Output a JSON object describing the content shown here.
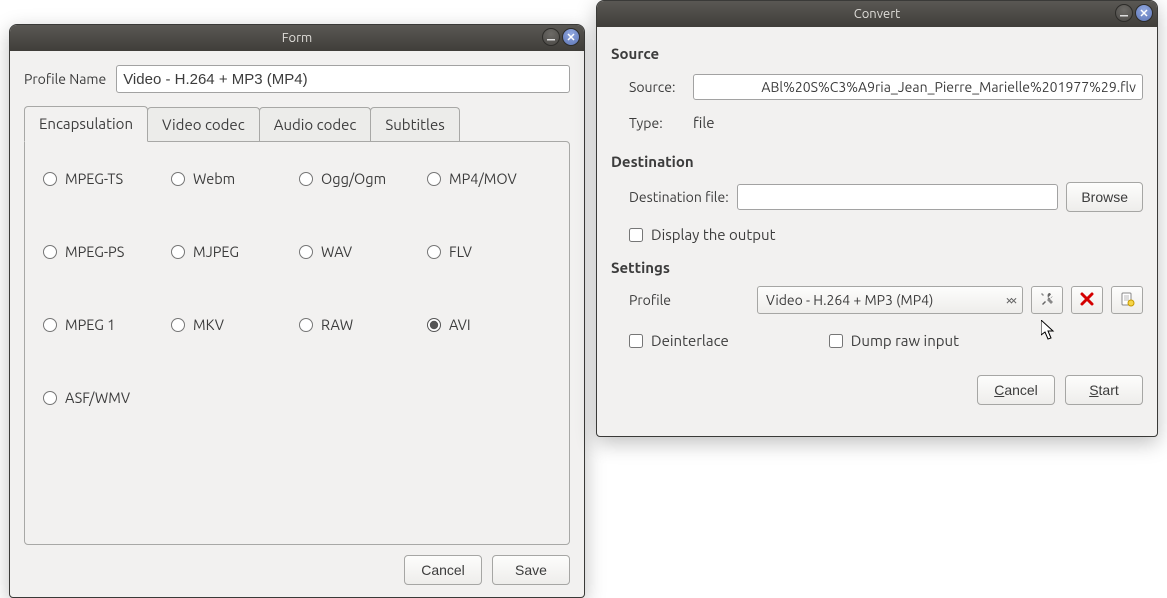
{
  "form_window": {
    "title": "Form",
    "profile_name_label": "Profile Name",
    "profile_name_value": "Video - H.264 + MP3 (MP4)",
    "tabs": {
      "encapsulation": "Encapsulation",
      "video_codec": "Video codec",
      "audio_codec": "Audio codec",
      "subtitles": "Subtitles"
    },
    "encapsulation_options": [
      "MPEG-TS",
      "Webm",
      "Ogg/Ogm",
      "MP4/MOV",
      "MPEG-PS",
      "MJPEG",
      "WAV",
      "FLV",
      "MPEG 1",
      "MKV",
      "RAW",
      "AVI",
      "ASF/WMV"
    ],
    "selected_encapsulation": "AVI",
    "buttons": {
      "cancel": "Cancel",
      "save": "Save"
    }
  },
  "convert_window": {
    "title": "Convert",
    "source_heading": "Source",
    "source_label": "Source:",
    "source_value": "ABl%20S%C3%A9ria_Jean_Pierre_Marielle%201977%29.flv",
    "type_label": "Type:",
    "type_value": "file",
    "destination_heading": "Destination",
    "destination_label": "Destination file:",
    "destination_value": "",
    "browse": "Browse",
    "display_output": "Display the output",
    "settings_heading": "Settings",
    "profile_label": "Profile",
    "profile_value": "Video - H.264 + MP3 (MP4)",
    "deinterlace": "Deinterlace",
    "dump_raw": "Dump raw input",
    "buttons": {
      "cancel": "Cancel",
      "start": "Start"
    }
  }
}
